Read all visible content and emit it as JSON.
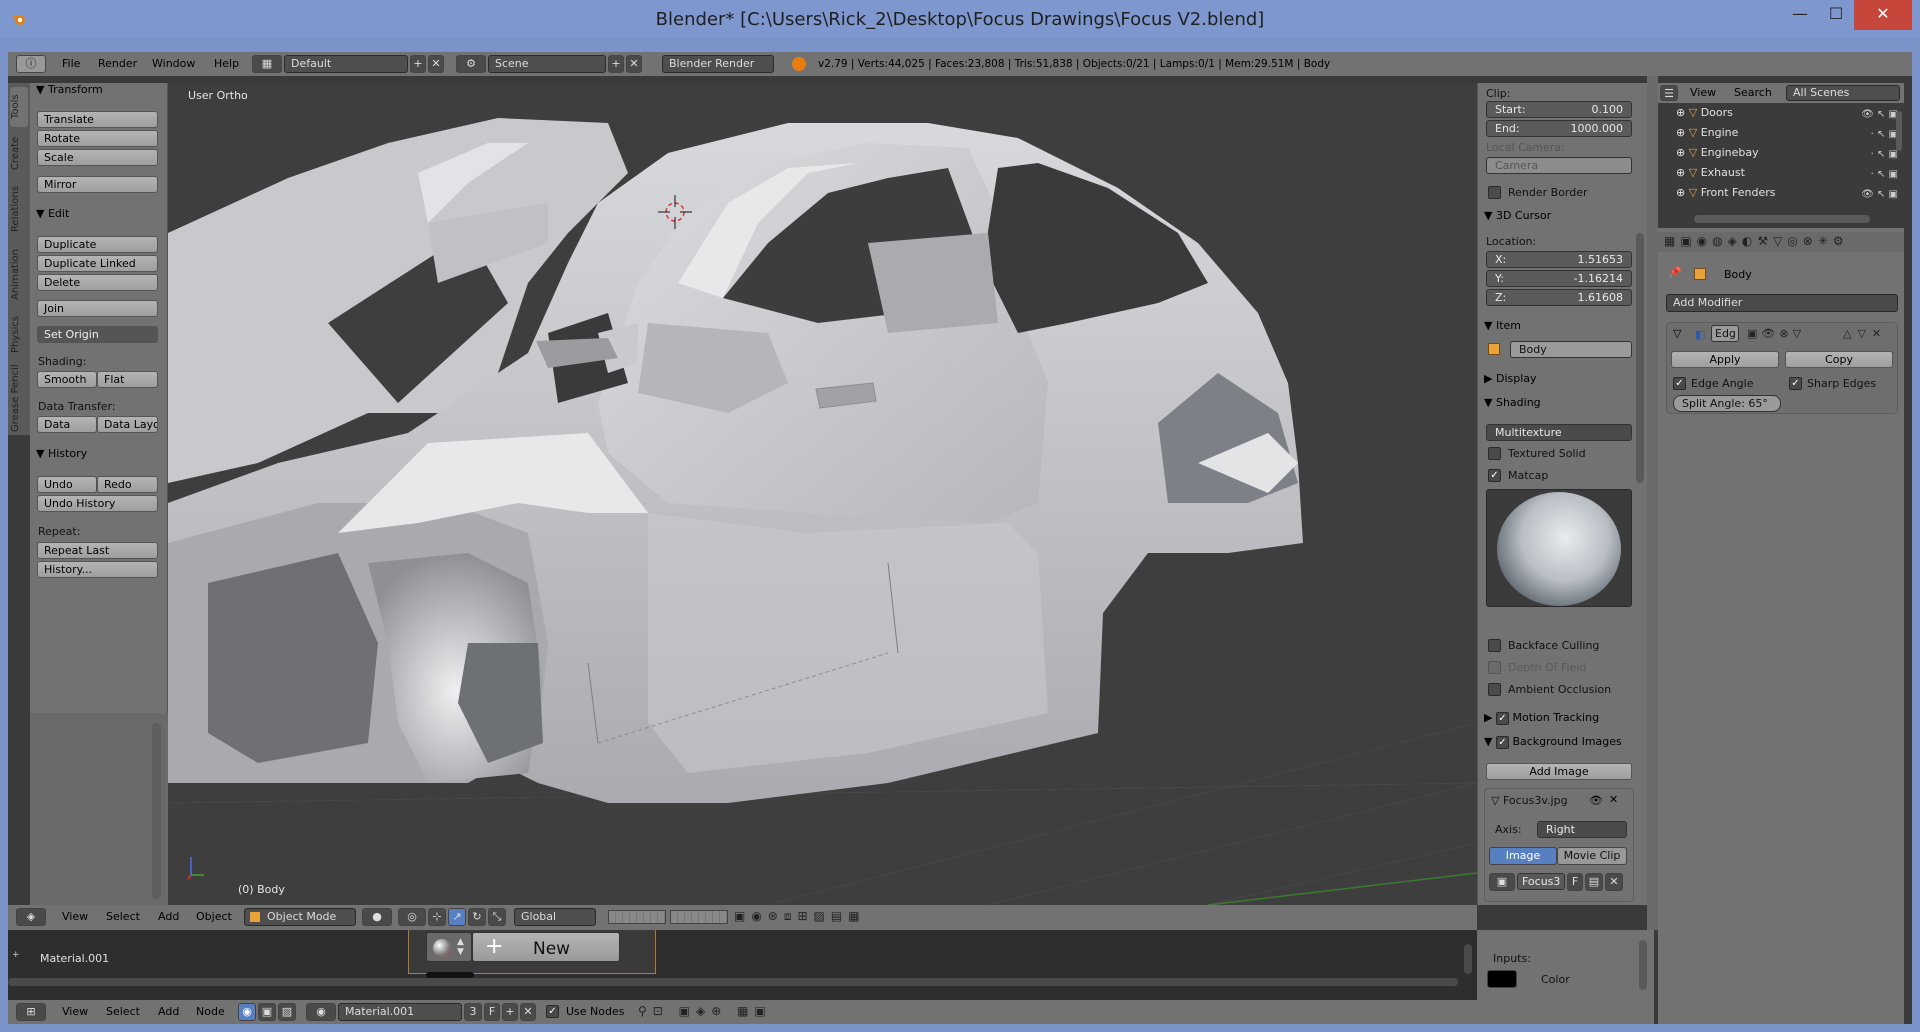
{
  "window": {
    "title": "Blender* [C:\\Users\\Rick_2\\Desktop\\Focus Drawings\\Focus V2.blend]",
    "minimize": "—",
    "maximize": "☐",
    "close": "✕"
  },
  "info_header": {
    "menus": [
      "File",
      "Render",
      "Window",
      "Help"
    ],
    "layout": "Default",
    "scene": "Scene",
    "engine": "Blender Render",
    "stats": "v2.79 | Verts:44,025 | Faces:23,808 | Tris:51,838 | Objects:0/21 | Lamps:0/1 | Mem:29.51M | Body"
  },
  "tool_tabs": [
    "Tools",
    "Create",
    "Relations",
    "Animation",
    "Physics",
    "Grease Pencil"
  ],
  "tools": {
    "transform": {
      "title": "Transform",
      "buttons": [
        "Translate",
        "Rotate",
        "Scale",
        "Mirror"
      ]
    },
    "edit": {
      "title": "Edit",
      "buttons": [
        "Duplicate",
        "Duplicate Linked",
        "Delete",
        "Join",
        "Set Origin"
      ]
    },
    "shading_label": "Shading:",
    "smooth": "Smooth",
    "flat": "Flat",
    "data_transfer_label": "Data Transfer:",
    "data": "Data",
    "data_layo": "Data Layo",
    "history": {
      "title": "History",
      "undo": "Undo",
      "redo": "Redo",
      "undo_history": "Undo History",
      "repeat_label": "Repeat:",
      "repeat_last": "Repeat Last",
      "history_btn": "History..."
    }
  },
  "viewport": {
    "view_label": "User Ortho",
    "object_label": "(0) Body"
  },
  "npanel": {
    "clip_label": "Clip:",
    "start_label": "Start:",
    "start_value": "0.100",
    "end_label": "End:",
    "end_value": "1000.000",
    "local_camera_label": "Local Camera:",
    "camera_placeholder": "Camera",
    "render_border": "Render Border",
    "cursor_title": "3D Cursor",
    "location_label": "Location:",
    "x_label": "X:",
    "x_value": "1.51653",
    "y_label": "Y:",
    "y_value": "-1.16214",
    "z_label": "Z:",
    "z_value": "1.61608",
    "item_title": "Item",
    "item_name": "Body",
    "display_title": "Display",
    "shading_title": "Shading",
    "shading_mode": "Multitexture",
    "textured_solid": "Textured Solid",
    "matcap": "Matcap",
    "backface_culling": "Backface Culling",
    "depth_of_field": "Depth Of Field",
    "ambient_occlusion": "Ambient Occlusion",
    "motion_tracking": "Motion Tracking",
    "background_images": "Background Images",
    "add_image": "Add Image",
    "bg_image_name": "Focus3v.jpg",
    "axis_label": "Axis:",
    "axis_value": "Right",
    "image_tab": "Image",
    "movie_clip_tab": "Movie Clip",
    "img_field": "Focus3",
    "img_f": "F"
  },
  "outliner": {
    "menus": [
      "View",
      "Search"
    ],
    "filter": "All Scenes",
    "items": [
      "Doors",
      "Engine",
      "Enginebay",
      "Exhaust",
      "Front Fenders"
    ]
  },
  "properties": {
    "object_name": "Body",
    "add_modifier": "Add Modifier",
    "mod_name": "Edg",
    "apply": "Apply",
    "copy": "Copy",
    "edge_angle": "Edge Angle",
    "sharp_edges": "Sharp Edges",
    "split_angle": "Split Angle: 65°"
  },
  "view3d_header": {
    "menus": [
      "View",
      "Select",
      "Add",
      "Object"
    ],
    "mode": "Object Mode",
    "orientation": "Global"
  },
  "node_area": {
    "material_label": "Material.001",
    "new_button": "New",
    "inputs_label": "Inputs:",
    "color_label": "Color"
  },
  "node_header": {
    "menus": [
      "View",
      "Select",
      "Add",
      "Node"
    ],
    "material_field": "Material.001",
    "users": "3",
    "fake": "F",
    "use_nodes": "Use Nodes"
  },
  "colors": {
    "accent": "#5680c2",
    "title_bg": "#7e98cf",
    "panel_bg": "#727272",
    "viewport_bg": "#3e3e3e"
  }
}
